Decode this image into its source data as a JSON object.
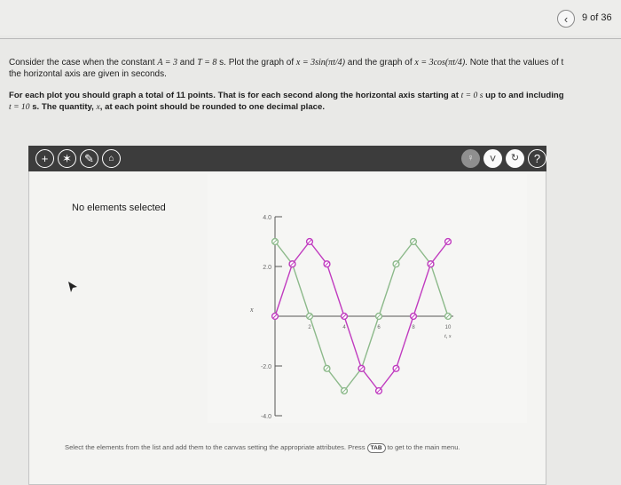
{
  "nav": {
    "back_icon": "chevron-left-icon",
    "page_counter": "9 of 36"
  },
  "question": {
    "line1": {
      "pre_a": "Consider the case when the constant ",
      "eq_a": "A = 3",
      "and": " and ",
      "eq_t": "T = 8",
      "s_plot": " s. Plot the graph of ",
      "eq_sin": "x = 3sin(πt/4)",
      "and_graph": " and the graph of ",
      "eq_cos": "x = 3cos(πt/4)",
      "note": ". Note that the values of t"
    },
    "line2": "the horizontal axis are given in seconds."
  },
  "instruction": {
    "line1_pre": "For each plot you should graph a total of 11 points. That is for each second along the horizontal axis starting at ",
    "line1_eq": "t = 0 s",
    "line1_post": " up to and including",
    "line2_eq": "t = 10",
    "line2_post": " s. The quantity, ",
    "line2_var": "x",
    "line2_end": ", at each point should be rounded to one decimal place."
  },
  "toolbar": {
    "left_tools": [
      {
        "name": "add-point-tool",
        "icon": "plus-icon",
        "glyph": "+"
      },
      {
        "name": "select-tool",
        "icon": "star-icon",
        "glyph": "✶"
      },
      {
        "name": "edit-tool",
        "icon": "pencil-icon",
        "glyph": "✎"
      },
      {
        "name": "delete-tool",
        "icon": "trash-icon",
        "glyph": "🗑"
      }
    ],
    "right_tools": [
      {
        "name": "hint-tool",
        "icon": "bulb-icon",
        "glyph": "💡"
      },
      {
        "name": "expand-tool",
        "icon": "chevron-down-icon",
        "glyph": "⌄"
      },
      {
        "name": "check-tool",
        "icon": "check-icon",
        "glyph": "✓"
      },
      {
        "name": "help-tool",
        "icon": "question-icon",
        "glyph": "?"
      }
    ]
  },
  "panel": {
    "selection_status": "No elements selected"
  },
  "footer": {
    "text_before": "Select the elements from the list and add them to the canvas setting the appropriate attributes. Press ",
    "tab_key": "TAB",
    "text_after": " to get to the main menu."
  },
  "colors": {
    "sin_series": "#c03bbf",
    "cos_series": "#8cb98a",
    "toolbar_bg": "#3c3c3c"
  },
  "chart_data": {
    "type": "line",
    "xlabel": "t, s",
    "ylabel": "x",
    "xlim": [
      0,
      10
    ],
    "ylim": [
      -4,
      4
    ],
    "x_ticks": [
      "2",
      "4",
      "6",
      "8",
      "10"
    ],
    "y_ticks": [
      "4.0",
      "2.0",
      "-2.0",
      "-4.0"
    ],
    "series": [
      {
        "values_x": [
          0,
          1,
          2,
          3,
          4,
          5,
          6,
          7,
          8,
          9,
          10
        ],
        "values_y": [
          0,
          2.1,
          3.0,
          2.1,
          0,
          -2.1,
          -3.0,
          -2.1,
          0,
          2.1,
          3.0
        ]
      },
      {
        "values_x": [
          0,
          1,
          2,
          3,
          4,
          5,
          6,
          7,
          8,
          9,
          10
        ],
        "values_y": [
          3.0,
          2.1,
          0,
          -2.1,
          -3.0,
          -2.1,
          0,
          2.1,
          3.0,
          2.1,
          0
        ]
      }
    ]
  }
}
